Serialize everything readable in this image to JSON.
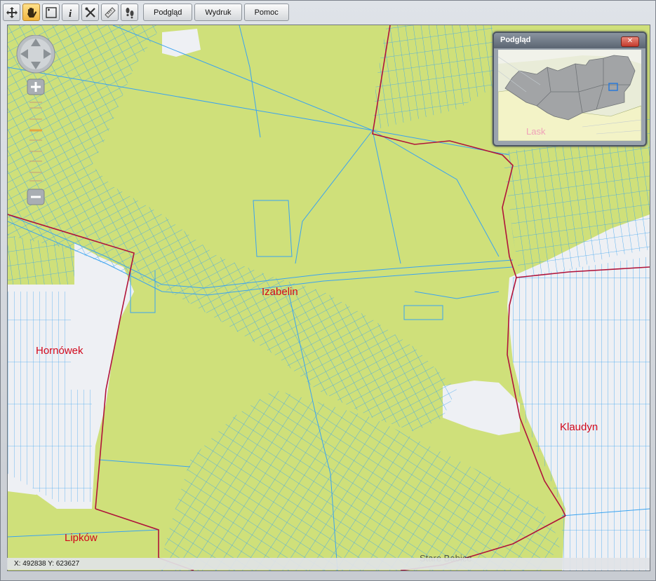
{
  "toolbar": {
    "tools": [
      {
        "name": "pan-move-icon"
      },
      {
        "name": "hand-icon"
      },
      {
        "name": "zoom-box-icon"
      },
      {
        "name": "info-icon"
      },
      {
        "name": "tools-icon"
      },
      {
        "name": "ruler-icon"
      },
      {
        "name": "footprints-icon"
      }
    ],
    "buttons": [
      {
        "label": "Podgląd"
      },
      {
        "label": "Wydruk"
      },
      {
        "label": "Pomoc"
      }
    ]
  },
  "map": {
    "places": [
      {
        "name": "Izabelin"
      },
      {
        "name": "Hornówek"
      },
      {
        "name": "Klaudyn"
      },
      {
        "name": "Lipków"
      }
    ],
    "partial_label": "Stare Babice",
    "colors": {
      "forest": "#cfe07a",
      "parcel_lines": "#3aa3f0",
      "boundary": "#b0133a",
      "built_area": "#eef0f4",
      "place_label": "#d1081c"
    }
  },
  "status": {
    "coords": "X: 492838 Y: 623627"
  },
  "preview": {
    "title": "Podgląd",
    "close": "✕",
    "label": "Lask"
  }
}
